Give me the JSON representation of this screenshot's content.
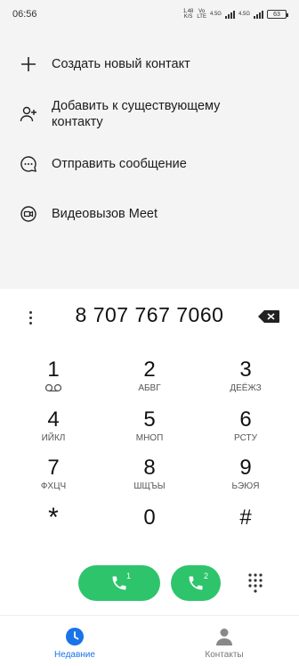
{
  "status": {
    "time": "06:56",
    "net_speed": "1,48",
    "net_unit": "K/S",
    "volte_top": "Vo",
    "volte_bottom": "LTE",
    "sim1_type": "4.5G",
    "sim2_type": "4.5G",
    "battery": "63"
  },
  "actions": [
    {
      "label": "Создать новый контакт",
      "icon": "plus-icon"
    },
    {
      "label": "Добавить к существующему контакту",
      "icon": "add-person-icon"
    },
    {
      "label": "Отправить сообщение",
      "icon": "message-icon"
    },
    {
      "label": "Видеовызов Meet",
      "icon": "meet-video-icon"
    }
  ],
  "dialer": {
    "number": "8 707 767 7060",
    "keys": [
      {
        "digit": "1",
        "letters": ""
      },
      {
        "digit": "2",
        "letters": "АБВГ"
      },
      {
        "digit": "3",
        "letters": "ДЕЁЖЗ"
      },
      {
        "digit": "4",
        "letters": "ИЙКЛ"
      },
      {
        "digit": "5",
        "letters": "МНОП"
      },
      {
        "digit": "6",
        "letters": "РСТУ"
      },
      {
        "digit": "7",
        "letters": "ФХЦЧ"
      },
      {
        "digit": "8",
        "letters": "ШЩЪЫ"
      },
      {
        "digit": "9",
        "letters": "ЬЭЮЯ"
      },
      {
        "digit": "*",
        "letters": ""
      },
      {
        "digit": "0",
        "letters": ""
      },
      {
        "digit": "#",
        "letters": ""
      }
    ],
    "call_sim1": "1",
    "call_sim2": "2",
    "call_color": "#2ec46c"
  },
  "nav": {
    "recent": "Недавние",
    "contacts": "Контакты",
    "active_color": "#1a73e8"
  }
}
